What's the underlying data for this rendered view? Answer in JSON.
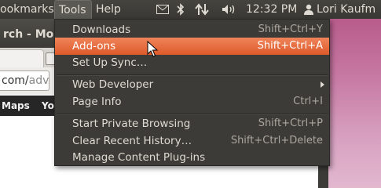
{
  "panel": {
    "menus": [
      "ookmarks",
      "Tools",
      "Help"
    ],
    "clock": "12:32 PM",
    "user": "Lori Kaufm",
    "indicators": [
      "mail-icon",
      "bluetooth-icon",
      "network-icon",
      "volume-icon",
      "user-icon"
    ]
  },
  "window": {
    "title": "rch - Mozi",
    "url_text": "com/adv",
    "url_grey": "adv",
    "bookmarks": [
      "Maps",
      "Yo"
    ]
  },
  "tools_menu": {
    "items": [
      {
        "label": "Downloads",
        "shortcut": "Shift+Ctrl+Y"
      },
      {
        "label": "Add-ons",
        "shortcut": "Shift+Ctrl+A",
        "highlighted": true
      },
      {
        "label": "Set Up Sync…",
        "shortcut": ""
      },
      {
        "label": "Web Developer",
        "shortcut": "",
        "submenu": true
      },
      {
        "label": "Page Info",
        "shortcut": "Ctrl+I"
      },
      {
        "label": "Start Private Browsing",
        "shortcut": "Shift+Ctrl+P"
      },
      {
        "label": "Clear Recent History…",
        "shortcut": "Shift+Ctrl+Delete"
      },
      {
        "label": "Manage Content Plug-ins",
        "shortcut": ""
      }
    ],
    "highlight_color": "#e8703f"
  }
}
